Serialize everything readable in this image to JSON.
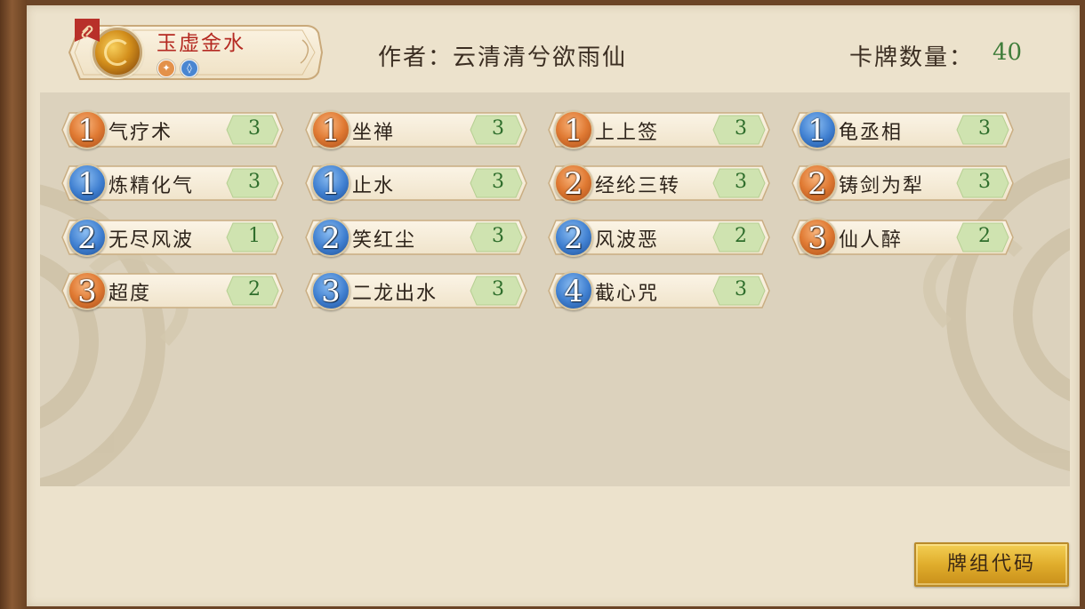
{
  "header": {
    "deck_name": "玉虚金水",
    "author_label": "作者：云清清兮欲雨仙",
    "count_label": "卡牌数量：",
    "count_value": "40",
    "elements": [
      {
        "name": "metal-icon",
        "color": "#e3914a",
        "glyph": "✦"
      },
      {
        "name": "water-icon",
        "color": "#4a86d1",
        "glyph": "💧"
      }
    ]
  },
  "cards": [
    {
      "cost": "1",
      "type": "orange",
      "name": "气疗术",
      "count": "3"
    },
    {
      "cost": "1",
      "type": "orange",
      "name": "坐禅",
      "count": "3"
    },
    {
      "cost": "1",
      "type": "orange",
      "name": "上上签",
      "count": "3"
    },
    {
      "cost": "1",
      "type": "blue",
      "name": "龟丞相",
      "count": "3"
    },
    {
      "cost": "1",
      "type": "blue",
      "name": "炼精化气",
      "count": "3"
    },
    {
      "cost": "1",
      "type": "blue",
      "name": "止水",
      "count": "3"
    },
    {
      "cost": "2",
      "type": "orange",
      "name": "经纶三转",
      "count": "3"
    },
    {
      "cost": "2",
      "type": "orange",
      "name": "铸剑为犁",
      "count": "3"
    },
    {
      "cost": "2",
      "type": "blue",
      "name": "无尽风波",
      "count": "1"
    },
    {
      "cost": "2",
      "type": "blue",
      "name": "笑红尘",
      "count": "3"
    },
    {
      "cost": "2",
      "type": "blue",
      "name": "风波恶",
      "count": "2"
    },
    {
      "cost": "3",
      "type": "orange",
      "name": "仙人醉",
      "count": "2"
    },
    {
      "cost": "3",
      "type": "orange",
      "name": "超度",
      "count": "2"
    },
    {
      "cost": "3",
      "type": "blue",
      "name": "二龙出水",
      "count": "3"
    },
    {
      "cost": "4",
      "type": "blue",
      "name": "截心咒",
      "count": "3"
    }
  ],
  "buttons": {
    "deck_code": "牌组代码"
  },
  "colors": {
    "paper": "#ece2cc",
    "panel": "#dcd2bd",
    "deck_name": "#b52a22",
    "count_value": "#3f7d3a",
    "orange_cost": "#e07a33",
    "blue_cost": "#3f7fd0",
    "count_tag": "#cfe3b0"
  }
}
